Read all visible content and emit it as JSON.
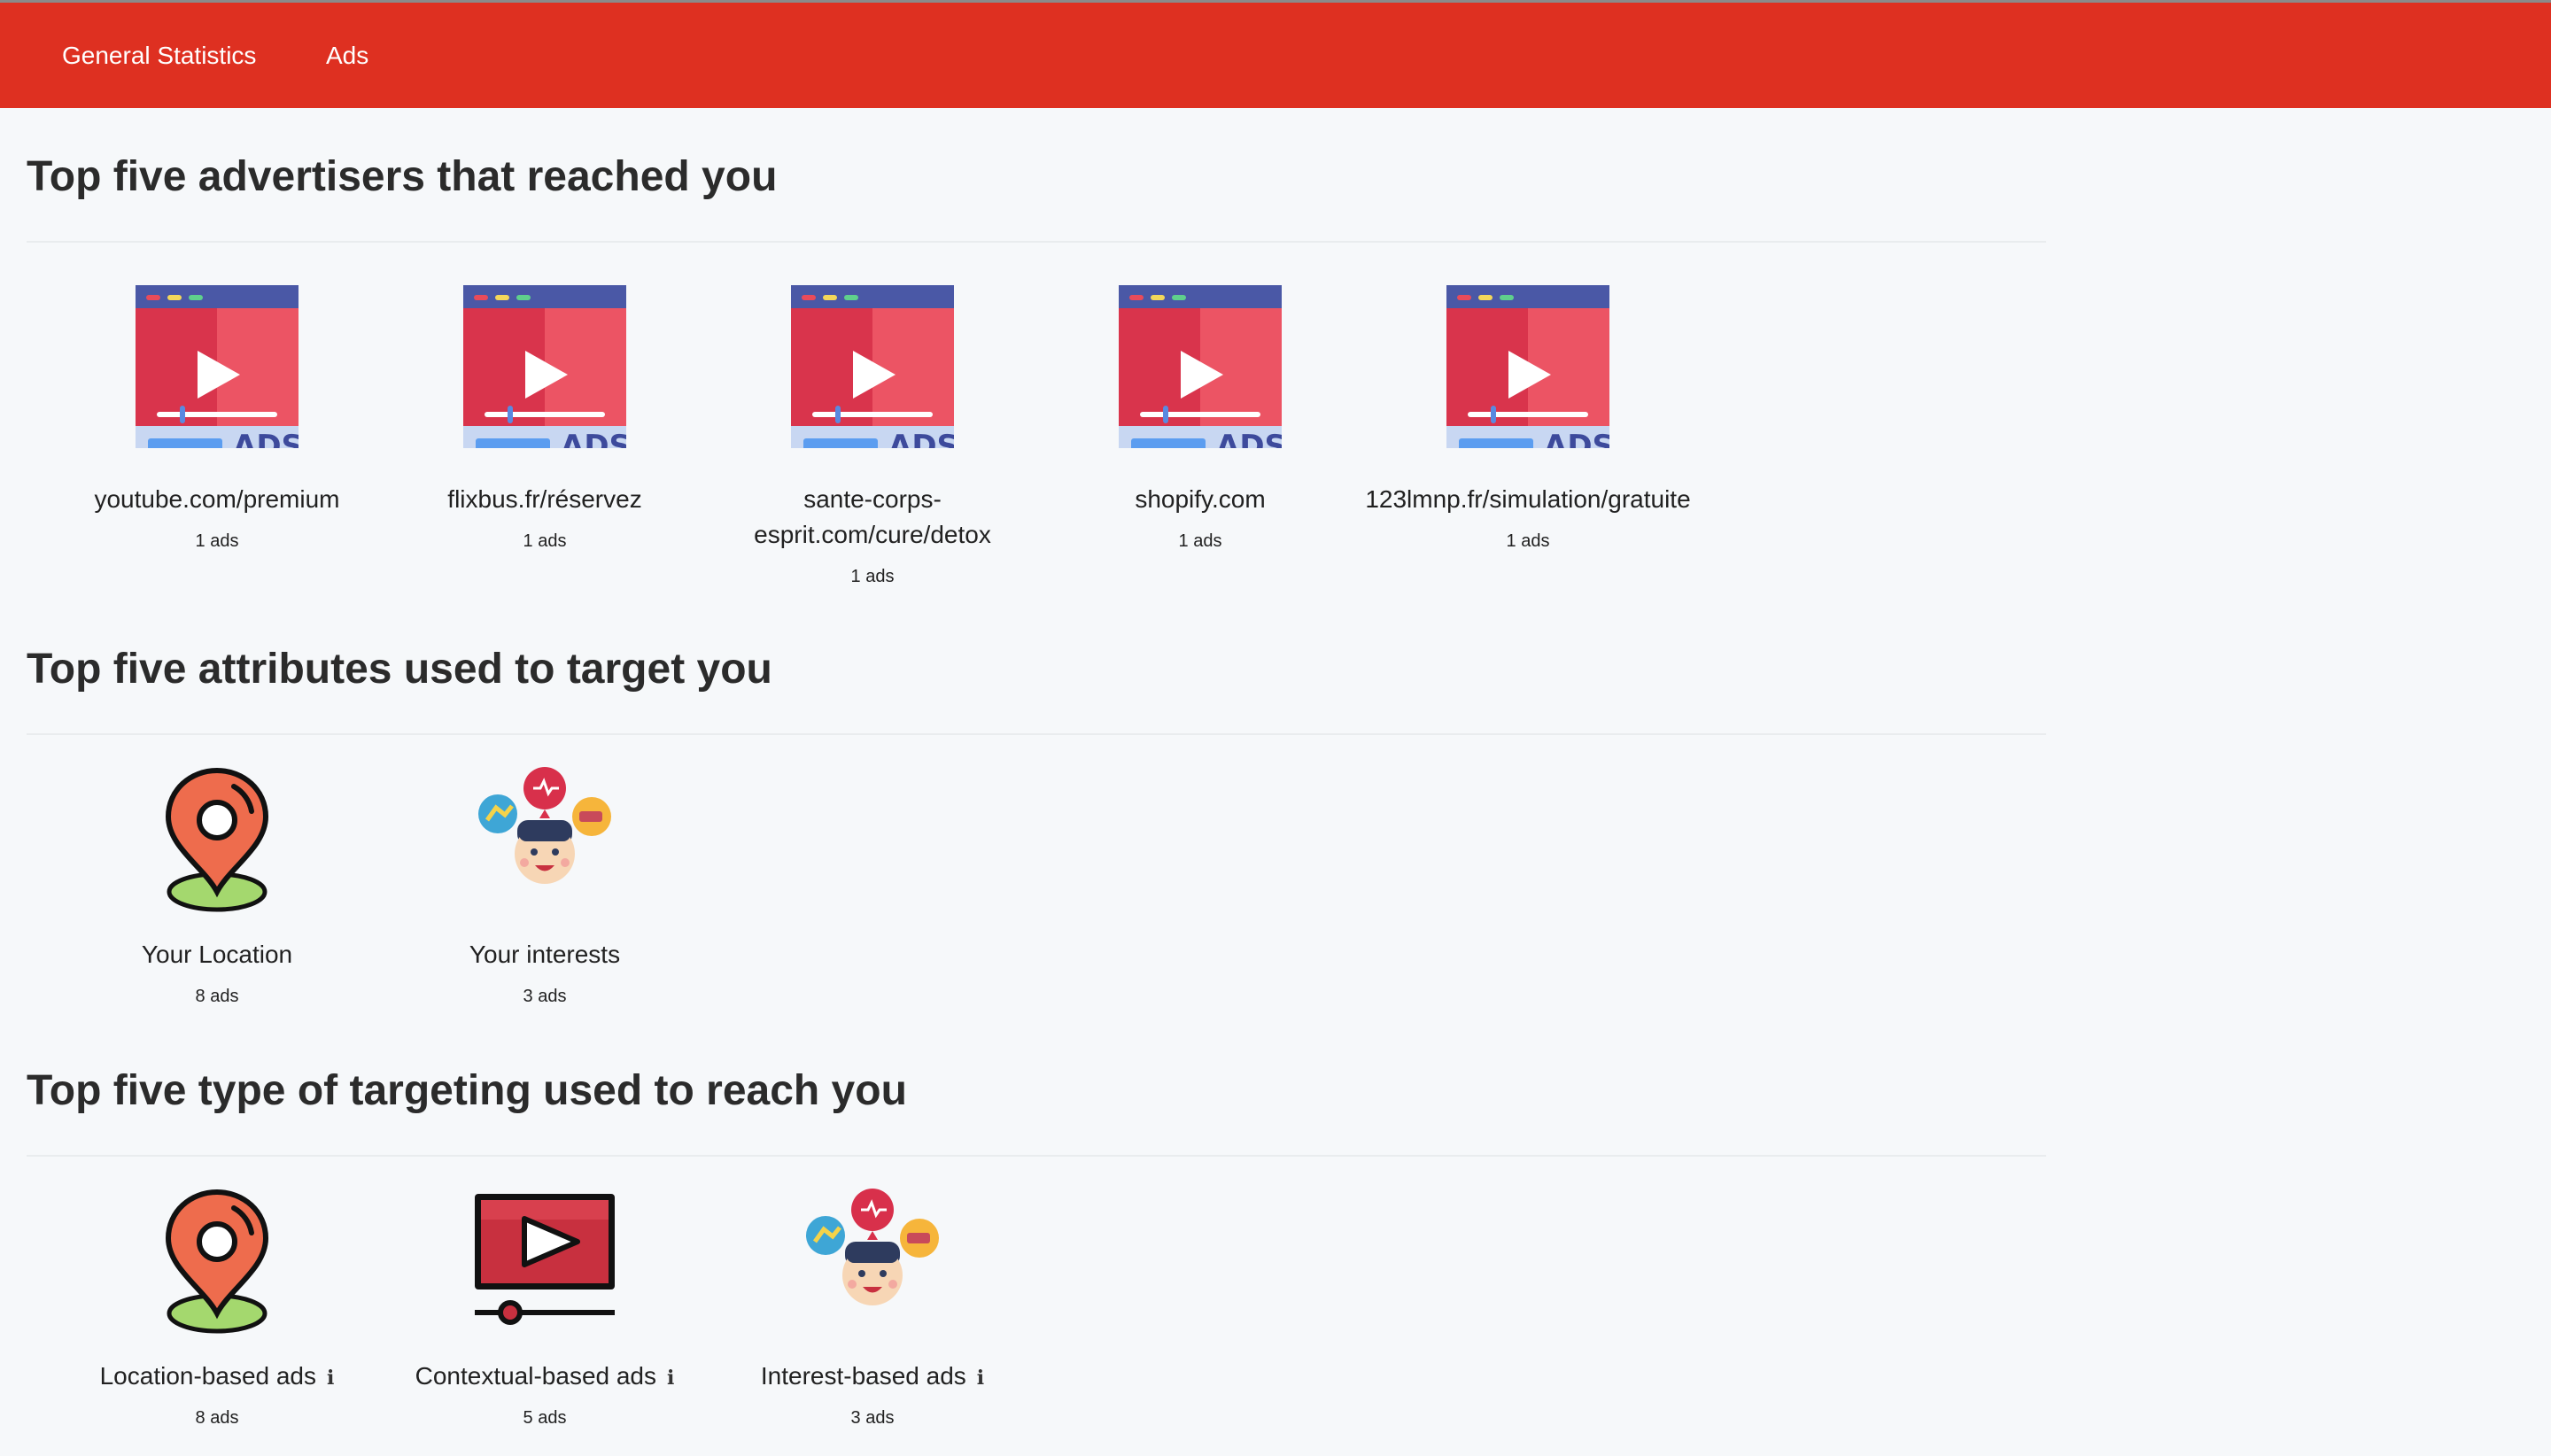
{
  "nav": {
    "general_statistics": "General Statistics",
    "ads": "Ads"
  },
  "advertisers_section": {
    "title": "Top five advertisers that reached you",
    "items": [
      {
        "name": "youtube.com/premium",
        "count": "1 ads",
        "icon": "video-ad-icon"
      },
      {
        "name": "flixbus.fr/réservez",
        "count": "1 ads",
        "icon": "video-ad-icon"
      },
      {
        "name": "sante-corps-esprit.com/cure/detox",
        "count": "1 ads",
        "icon": "video-ad-icon"
      },
      {
        "name": "shopify.com",
        "count": "1 ads",
        "icon": "video-ad-icon"
      },
      {
        "name": "123lmnp.fr/simulation/gratuite",
        "count": "1 ads",
        "icon": "video-ad-icon"
      }
    ],
    "icon_badge_text": "ADS"
  },
  "attributes_section": {
    "title": "Top five attributes used to target you",
    "items": [
      {
        "name": "Your Location",
        "count": "8 ads",
        "icon": "location-pin-icon"
      },
      {
        "name": "Your interests",
        "count": "3 ads",
        "icon": "interests-person-icon"
      }
    ]
  },
  "targeting_section": {
    "title": "Top five type of targeting used to reach you",
    "items": [
      {
        "name": "Location-based ads",
        "count": "8 ads",
        "icon": "location-pin-icon"
      },
      {
        "name": "Contextual-based ads",
        "count": "5 ads",
        "icon": "video-player-icon"
      },
      {
        "name": "Interest-based ads",
        "count": "3 ads",
        "icon": "interests-person-icon"
      }
    ],
    "info_glyph": "i"
  },
  "colors": {
    "header": "#de3021",
    "background": "#f6f8fa",
    "ad_red": "#e94b5a",
    "ad_dark_red": "#d6324b",
    "ad_blue_bar": "#4a58a6",
    "ad_badge_bg": "#c8d7f2",
    "ad_badge_text": "#3d4a9c"
  }
}
